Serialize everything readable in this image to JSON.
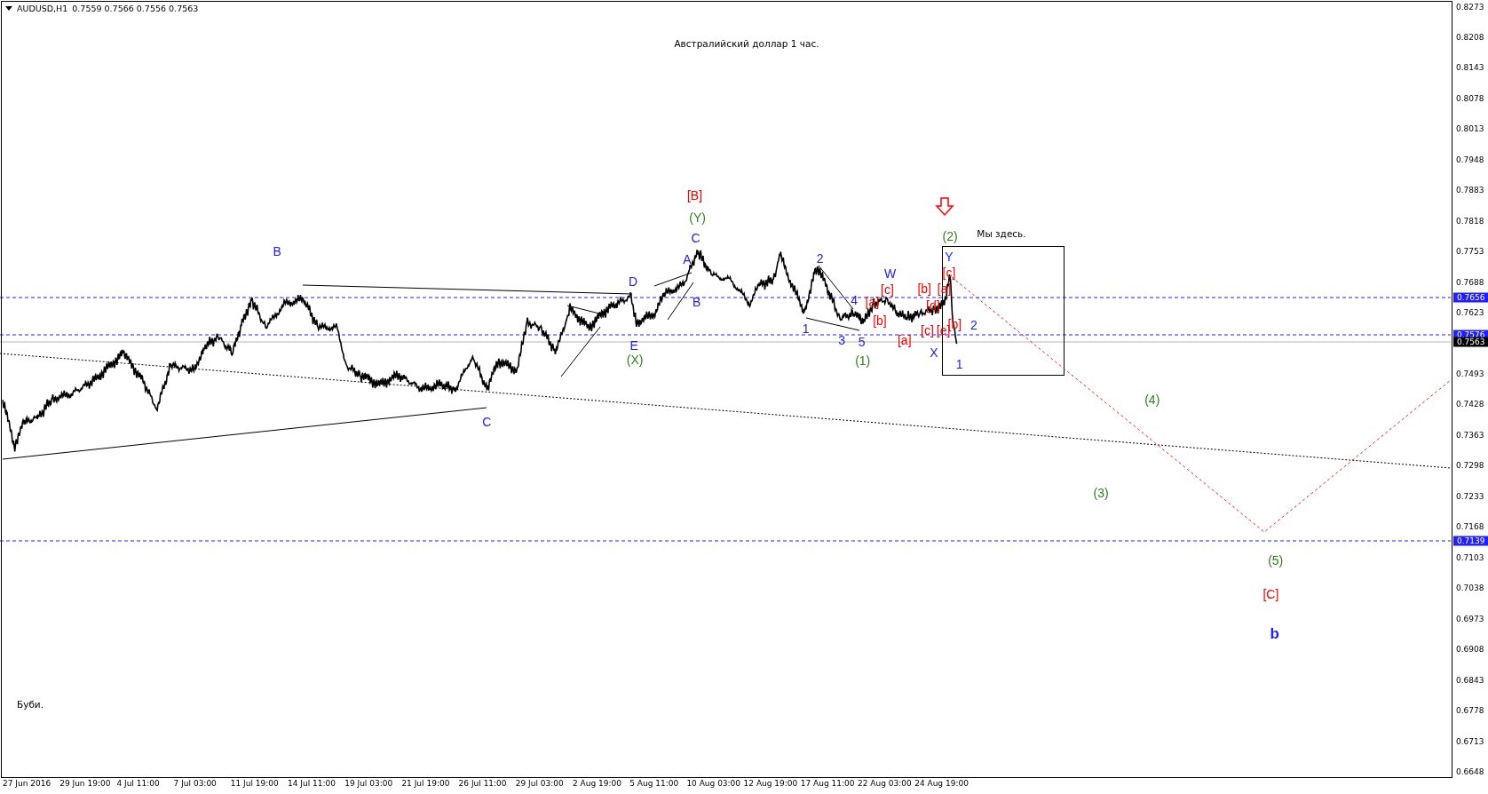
{
  "header": {
    "symbol": "AUDUSD,H1",
    "ohlc": "0.7559 0.7566 0.7556 0.7563"
  },
  "chart": {
    "title": "Австралийский доллар 1 час.",
    "note": "Буби.",
    "here_label": "Мы здесь.",
    "annotations": [
      {
        "text": "[B]",
        "color": "#ff0000",
        "bold": false
      },
      {
        "text": "(Y)",
        "color": "#308020",
        "bold": false
      },
      {
        "text": "C",
        "color": "#2020ff",
        "bold": false
      },
      {
        "text": "(2)",
        "color": "#308020",
        "bold": false
      },
      {
        "text": "B",
        "color": "#2020ff",
        "bold": false
      },
      {
        "text": "A",
        "color": "#2020ff",
        "bold": false
      },
      {
        "text": "2",
        "color": "#2020ff",
        "bold": false
      },
      {
        "text": "Y",
        "color": "#2020ff",
        "bold": false
      },
      {
        "text": "D",
        "color": "#2020ff",
        "bold": false
      },
      {
        "text": "W",
        "color": "#2020ff",
        "bold": false
      },
      {
        "text": "[c]",
        "color": "#ff0000",
        "bold": false
      },
      {
        "text": "[c]",
        "color": "#ff0000",
        "bold": false
      },
      {
        "text": "[b]",
        "color": "#ff0000",
        "bold": false
      },
      {
        "text": "[a]",
        "color": "#ff0000",
        "bold": false
      },
      {
        "text": "B",
        "color": "#2020ff",
        "bold": false
      },
      {
        "text": "4",
        "color": "#2020ff",
        "bold": false
      },
      {
        "text": "[a]",
        "color": "#ff0000",
        "bold": false
      },
      {
        "text": "[d]",
        "color": "#ff0000",
        "bold": false
      },
      {
        "text": "1",
        "color": "#2020ff",
        "bold": false
      },
      {
        "text": "[b]",
        "color": "#ff0000",
        "bold": false
      },
      {
        "text": "[c]",
        "color": "#ff0000",
        "bold": false
      },
      {
        "text": "[e]",
        "color": "#ff0000",
        "bold": false
      },
      {
        "text": "[b]",
        "color": "#ff0000",
        "bold": false
      },
      {
        "text": "2",
        "color": "#2020ff",
        "bold": false
      },
      {
        "text": "E",
        "color": "#2020ff",
        "bold": false
      },
      {
        "text": "3",
        "color": "#2020ff",
        "bold": false
      },
      {
        "text": "5",
        "color": "#2020ff",
        "bold": false
      },
      {
        "text": "[a]",
        "color": "#ff0000",
        "bold": false
      },
      {
        "text": "(X)",
        "color": "#308020",
        "bold": false
      },
      {
        "text": "(1)",
        "color": "#308020",
        "bold": false
      },
      {
        "text": "X",
        "color": "#2020ff",
        "bold": false
      },
      {
        "text": "1",
        "color": "#2020ff",
        "bold": false
      },
      {
        "text": "(4)",
        "color": "#308020",
        "bold": false
      },
      {
        "text": "C",
        "color": "#2020ff",
        "bold": false
      },
      {
        "text": "(3)",
        "color": "#308020",
        "bold": false
      },
      {
        "text": "(5)",
        "color": "#308020",
        "bold": false
      },
      {
        "text": "[C]",
        "color": "#ff0000",
        "bold": false
      },
      {
        "text": "b",
        "color": "#2020ff",
        "bold": true
      }
    ]
  },
  "price_axis": [
    "0.8273",
    "0.8208",
    "0.8143",
    "0.8078",
    "0.8013",
    "0.7948",
    "0.7883",
    "0.7818",
    "0.7753",
    "0.7688",
    "0.7623",
    "0.7493",
    "0.7428",
    "0.7363",
    "0.7298",
    "0.7233",
    "0.7168",
    "0.7103",
    "0.7038",
    "0.6973",
    "0.6908",
    "0.6843",
    "0.6778",
    "0.6713",
    "0.6648"
  ],
  "price_markers": [
    {
      "value": "0.7656",
      "kind": "level"
    },
    {
      "value": "0.7576",
      "kind": "level"
    },
    {
      "value": "0.7563",
      "kind": "current"
    },
    {
      "value": "0.7139",
      "kind": "level"
    }
  ],
  "time_axis": [
    "27 Jun 2016",
    "29 Jun 19:00",
    "4 Jul 11:00",
    "7 Jul 03:00",
    "11 Jul 19:00",
    "14 Jul 11:00",
    "19 Jul 03:00",
    "21 Jul 19:00",
    "26 Jul 11:00",
    "29 Jul 03:00",
    "2 Aug 19:00",
    "5 Aug 11:00",
    "10 Aug 03:00",
    "12 Aug 19:00",
    "17 Aug 11:00",
    "22 Aug 03:00",
    "24 Aug 19:00"
  ]
}
